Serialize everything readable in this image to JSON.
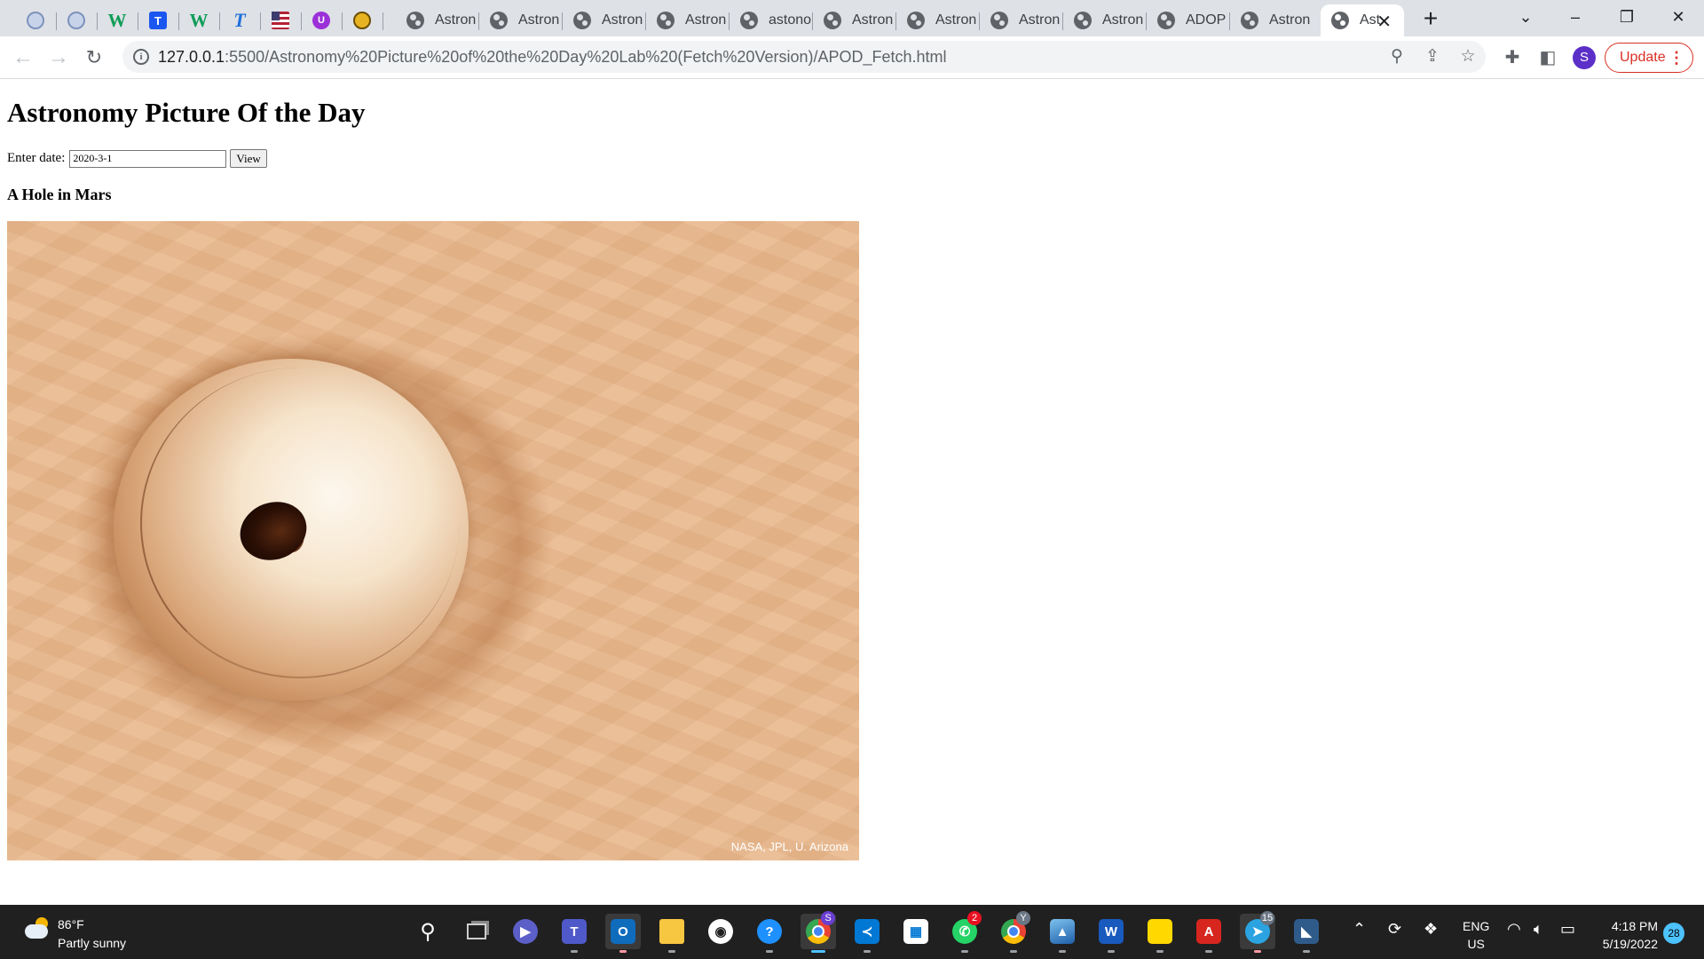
{
  "browser": {
    "tabs": [
      {
        "title": "",
        "icon": "nasa-icon"
      },
      {
        "title": "",
        "icon": "nasa-icon"
      },
      {
        "title": "",
        "icon": "w-green-icon"
      },
      {
        "title": "",
        "icon": "t-blue-icon"
      },
      {
        "title": "",
        "icon": "w-green-icon"
      },
      {
        "title": "",
        "icon": "t-italic-icon"
      },
      {
        "title": "",
        "icon": "us-flag-icon"
      },
      {
        "title": "",
        "icon": "purple-circle-icon"
      },
      {
        "title": "",
        "icon": "badge-icon"
      },
      {
        "title": "Astron",
        "icon": "globe-icon"
      },
      {
        "title": "Astron",
        "icon": "globe-icon"
      },
      {
        "title": "Astron",
        "icon": "globe-icon"
      },
      {
        "title": "Astron",
        "icon": "globe-icon"
      },
      {
        "title": "astono",
        "icon": "globe-icon"
      },
      {
        "title": "Astron",
        "icon": "globe-icon"
      },
      {
        "title": "Astron",
        "icon": "globe-icon"
      },
      {
        "title": "Astron",
        "icon": "globe-icon"
      },
      {
        "title": "Astron",
        "icon": "globe-icon"
      },
      {
        "title": "ADOP",
        "icon": "globe-icon"
      },
      {
        "title": "Astron",
        "icon": "globe-icon"
      },
      {
        "title": "Ast",
        "icon": "globe-icon",
        "active": true
      }
    ],
    "new_tab": "+",
    "window_controls": {
      "list": "⌄",
      "minimize": "–",
      "restore": "❐",
      "close": "✕"
    },
    "address": {
      "host": "127.0.0.1",
      "path": ":5500/Astronomy%20Picture%20of%20the%20Day%20Lab%20(Fetch%20Version)/APOD_Fetch.html"
    },
    "profile_initial": "S",
    "update_label": "Update"
  },
  "page": {
    "heading": "Astronomy Picture Of the Day",
    "date_label": "Enter date:",
    "date_value": "2020-3-1",
    "view_button": "View",
    "apod_title": "A Hole in Mars",
    "image_credit": "NASA, JPL, U. Arizona"
  },
  "taskbar": {
    "weather_temp": "86°F",
    "weather_condition": "Partly sunny",
    "apps": [
      {
        "name": "windows-start-icon"
      },
      {
        "name": "search-icon"
      },
      {
        "name": "task-view-icon"
      },
      {
        "name": "chat-icon"
      },
      {
        "name": "teams-icon"
      },
      {
        "name": "outlook-icon"
      },
      {
        "name": "file-explorer-icon"
      },
      {
        "name": "github-icon"
      },
      {
        "name": "help-icon"
      },
      {
        "name": "chrome-icon",
        "badge": "S"
      },
      {
        "name": "vscode-icon"
      },
      {
        "name": "store-icon"
      },
      {
        "name": "whatsapp-icon",
        "badge": "2"
      },
      {
        "name": "chrome-profile-icon",
        "badge": "Y"
      },
      {
        "name": "photos-icon"
      },
      {
        "name": "word-icon"
      },
      {
        "name": "sticky-notes-icon"
      },
      {
        "name": "acrobat-icon"
      },
      {
        "name": "telegram-icon",
        "badge": "15"
      },
      {
        "name": "remote-app-icon"
      }
    ],
    "language_top": "ENG",
    "language_bottom": "US",
    "time": "4:18 PM",
    "date": "5/19/2022",
    "notification_count": "28"
  },
  "colors": {
    "tabstrip": "#dee1e6",
    "update_accent": "#d93025",
    "taskbar": "#202020",
    "mars_surface": "#e9b98f"
  }
}
